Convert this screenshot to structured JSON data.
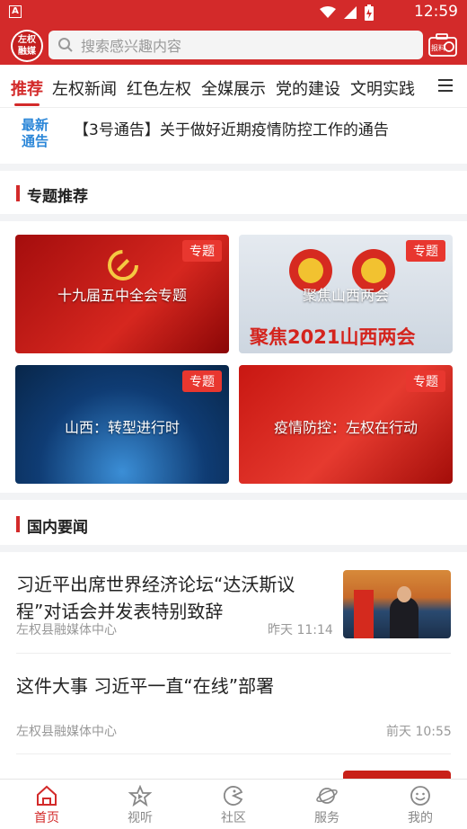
{
  "status": {
    "time": "12:59"
  },
  "header": {
    "logo_line1": "左权",
    "logo_line2": "融媒",
    "search_placeholder": "搜索感兴趣内容",
    "report_label": "报料"
  },
  "tabs": [
    "推荐",
    "左权新闻",
    "红色左权",
    "全媒展示",
    "党的建设",
    "文明实践"
  ],
  "notice": {
    "badge_line1": "最新",
    "badge_line2": "通告",
    "text": "【3号通告】关于做好近期疫情防控工作的通告"
  },
  "topics": {
    "title": "专题推荐",
    "tag": "专题",
    "items": [
      {
        "title": "十九届五中全会专题"
      },
      {
        "title": "聚焦山西两会",
        "banner": "聚焦2021山西两会"
      },
      {
        "title": "山西：转型进行时"
      },
      {
        "title": "疫情防控：左权在行动"
      }
    ]
  },
  "domestic": {
    "title": "国内要闻",
    "items": [
      {
        "title_line1": "习近平出席世界经济论坛“达沃斯议",
        "title_line2": "程”对话会并发表特别致辞",
        "source": "左权县融媒体中心",
        "time": "昨天 11:14"
      },
      {
        "title": "这件大事 习近平一直“在线”部署",
        "source": "左权县融媒体中心",
        "time": "前天 10:55"
      }
    ]
  },
  "bottom_nav": [
    "首页",
    "视听",
    "社区",
    "服务",
    "我的"
  ],
  "colors": {
    "brand": "#d32a2a",
    "notice_blue": "#2a86d8",
    "tag_red": "#e8372f"
  }
}
